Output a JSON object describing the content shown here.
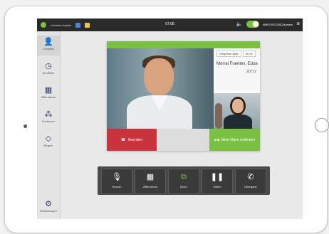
{
  "statusbar": {
    "carrier": "eVolution Mobile",
    "time": "07:08",
    "user_id": "4989700722082/system"
  },
  "sidebar": {
    "items": [
      {
        "label": "Kontakte",
        "icon": "person-icon"
      },
      {
        "label": "Anrufliste",
        "icon": "clock-icon"
      },
      {
        "label": "Ziffernblock",
        "icon": "keypad-icon"
      },
      {
        "label": "Konferenz",
        "icon": "conference-icon"
      },
      {
        "label": "Regeln",
        "icon": "rules-icon"
      },
      {
        "label": "Einstellungen",
        "icon": "settings-icon"
      }
    ]
  },
  "call": {
    "status": "Gespräch aktiv",
    "duration": "00:15",
    "contact_name": "Morral Fuentes, Edua",
    "contact_number": "20712",
    "end_label": "Beenden",
    "video_label": "Mein Video entfernen"
  },
  "controls": [
    {
      "label": "Stumm",
      "icon": "microphone-icon"
    },
    {
      "label": "Ziffernblock",
      "icon": "keypad-icon"
    },
    {
      "label": "Move",
      "icon": "move-icon"
    },
    {
      "label": "Halten",
      "icon": "pause-icon"
    },
    {
      "label": "Übergabe",
      "icon": "transfer-icon"
    }
  ],
  "colors": {
    "accent": "#7ac143",
    "danger": "#c8333d",
    "nav": "#2c3e6b"
  }
}
